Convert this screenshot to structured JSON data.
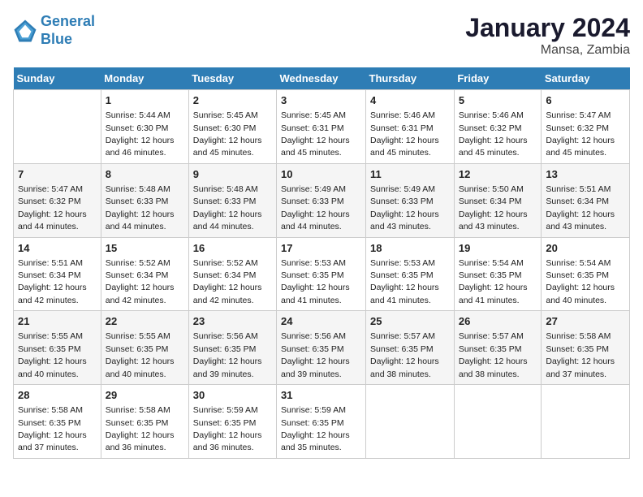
{
  "header": {
    "logo_line1": "General",
    "logo_line2": "Blue",
    "title": "January 2024",
    "subtitle": "Mansa, Zambia"
  },
  "columns": [
    "Sunday",
    "Monday",
    "Tuesday",
    "Wednesday",
    "Thursday",
    "Friday",
    "Saturday"
  ],
  "weeks": [
    [
      {
        "day": "",
        "sunrise": "",
        "sunset": "",
        "daylight": ""
      },
      {
        "day": "1",
        "sunrise": "Sunrise: 5:44 AM",
        "sunset": "Sunset: 6:30 PM",
        "daylight": "Daylight: 12 hours and 46 minutes."
      },
      {
        "day": "2",
        "sunrise": "Sunrise: 5:45 AM",
        "sunset": "Sunset: 6:30 PM",
        "daylight": "Daylight: 12 hours and 45 minutes."
      },
      {
        "day": "3",
        "sunrise": "Sunrise: 5:45 AM",
        "sunset": "Sunset: 6:31 PM",
        "daylight": "Daylight: 12 hours and 45 minutes."
      },
      {
        "day": "4",
        "sunrise": "Sunrise: 5:46 AM",
        "sunset": "Sunset: 6:31 PM",
        "daylight": "Daylight: 12 hours and 45 minutes."
      },
      {
        "day": "5",
        "sunrise": "Sunrise: 5:46 AM",
        "sunset": "Sunset: 6:32 PM",
        "daylight": "Daylight: 12 hours and 45 minutes."
      },
      {
        "day": "6",
        "sunrise": "Sunrise: 5:47 AM",
        "sunset": "Sunset: 6:32 PM",
        "daylight": "Daylight: 12 hours and 45 minutes."
      }
    ],
    [
      {
        "day": "7",
        "sunrise": "Sunrise: 5:47 AM",
        "sunset": "Sunset: 6:32 PM",
        "daylight": "Daylight: 12 hours and 44 minutes."
      },
      {
        "day": "8",
        "sunrise": "Sunrise: 5:48 AM",
        "sunset": "Sunset: 6:33 PM",
        "daylight": "Daylight: 12 hours and 44 minutes."
      },
      {
        "day": "9",
        "sunrise": "Sunrise: 5:48 AM",
        "sunset": "Sunset: 6:33 PM",
        "daylight": "Daylight: 12 hours and 44 minutes."
      },
      {
        "day": "10",
        "sunrise": "Sunrise: 5:49 AM",
        "sunset": "Sunset: 6:33 PM",
        "daylight": "Daylight: 12 hours and 44 minutes."
      },
      {
        "day": "11",
        "sunrise": "Sunrise: 5:49 AM",
        "sunset": "Sunset: 6:33 PM",
        "daylight": "Daylight: 12 hours and 43 minutes."
      },
      {
        "day": "12",
        "sunrise": "Sunrise: 5:50 AM",
        "sunset": "Sunset: 6:34 PM",
        "daylight": "Daylight: 12 hours and 43 minutes."
      },
      {
        "day": "13",
        "sunrise": "Sunrise: 5:51 AM",
        "sunset": "Sunset: 6:34 PM",
        "daylight": "Daylight: 12 hours and 43 minutes."
      }
    ],
    [
      {
        "day": "14",
        "sunrise": "Sunrise: 5:51 AM",
        "sunset": "Sunset: 6:34 PM",
        "daylight": "Daylight: 12 hours and 42 minutes."
      },
      {
        "day": "15",
        "sunrise": "Sunrise: 5:52 AM",
        "sunset": "Sunset: 6:34 PM",
        "daylight": "Daylight: 12 hours and 42 minutes."
      },
      {
        "day": "16",
        "sunrise": "Sunrise: 5:52 AM",
        "sunset": "Sunset: 6:34 PM",
        "daylight": "Daylight: 12 hours and 42 minutes."
      },
      {
        "day": "17",
        "sunrise": "Sunrise: 5:53 AM",
        "sunset": "Sunset: 6:35 PM",
        "daylight": "Daylight: 12 hours and 41 minutes."
      },
      {
        "day": "18",
        "sunrise": "Sunrise: 5:53 AM",
        "sunset": "Sunset: 6:35 PM",
        "daylight": "Daylight: 12 hours and 41 minutes."
      },
      {
        "day": "19",
        "sunrise": "Sunrise: 5:54 AM",
        "sunset": "Sunset: 6:35 PM",
        "daylight": "Daylight: 12 hours and 41 minutes."
      },
      {
        "day": "20",
        "sunrise": "Sunrise: 5:54 AM",
        "sunset": "Sunset: 6:35 PM",
        "daylight": "Daylight: 12 hours and 40 minutes."
      }
    ],
    [
      {
        "day": "21",
        "sunrise": "Sunrise: 5:55 AM",
        "sunset": "Sunset: 6:35 PM",
        "daylight": "Daylight: 12 hours and 40 minutes."
      },
      {
        "day": "22",
        "sunrise": "Sunrise: 5:55 AM",
        "sunset": "Sunset: 6:35 PM",
        "daylight": "Daylight: 12 hours and 40 minutes."
      },
      {
        "day": "23",
        "sunrise": "Sunrise: 5:56 AM",
        "sunset": "Sunset: 6:35 PM",
        "daylight": "Daylight: 12 hours and 39 minutes."
      },
      {
        "day": "24",
        "sunrise": "Sunrise: 5:56 AM",
        "sunset": "Sunset: 6:35 PM",
        "daylight": "Daylight: 12 hours and 39 minutes."
      },
      {
        "day": "25",
        "sunrise": "Sunrise: 5:57 AM",
        "sunset": "Sunset: 6:35 PM",
        "daylight": "Daylight: 12 hours and 38 minutes."
      },
      {
        "day": "26",
        "sunrise": "Sunrise: 5:57 AM",
        "sunset": "Sunset: 6:35 PM",
        "daylight": "Daylight: 12 hours and 38 minutes."
      },
      {
        "day": "27",
        "sunrise": "Sunrise: 5:58 AM",
        "sunset": "Sunset: 6:35 PM",
        "daylight": "Daylight: 12 hours and 37 minutes."
      }
    ],
    [
      {
        "day": "28",
        "sunrise": "Sunrise: 5:58 AM",
        "sunset": "Sunset: 6:35 PM",
        "daylight": "Daylight: 12 hours and 37 minutes."
      },
      {
        "day": "29",
        "sunrise": "Sunrise: 5:58 AM",
        "sunset": "Sunset: 6:35 PM",
        "daylight": "Daylight: 12 hours and 36 minutes."
      },
      {
        "day": "30",
        "sunrise": "Sunrise: 5:59 AM",
        "sunset": "Sunset: 6:35 PM",
        "daylight": "Daylight: 12 hours and 36 minutes."
      },
      {
        "day": "31",
        "sunrise": "Sunrise: 5:59 AM",
        "sunset": "Sunset: 6:35 PM",
        "daylight": "Daylight: 12 hours and 35 minutes."
      },
      {
        "day": "",
        "sunrise": "",
        "sunset": "",
        "daylight": ""
      },
      {
        "day": "",
        "sunrise": "",
        "sunset": "",
        "daylight": ""
      },
      {
        "day": "",
        "sunrise": "",
        "sunset": "",
        "daylight": ""
      }
    ]
  ]
}
